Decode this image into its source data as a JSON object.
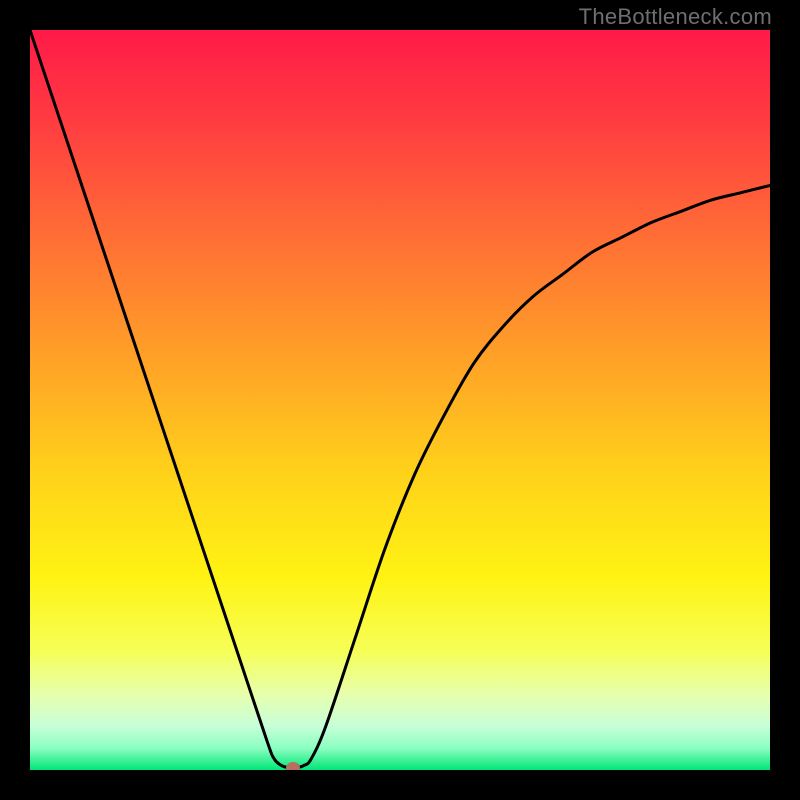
{
  "watermark": "TheBottleneck.com",
  "chart_data": {
    "type": "line",
    "title": "",
    "xlabel": "",
    "ylabel": "",
    "xlim": [
      0,
      100
    ],
    "ylim": [
      0,
      100
    ],
    "grid": false,
    "legend": false,
    "series": [
      {
        "name": "bottleneck-curve",
        "x": [
          0,
          4,
          8,
          12,
          16,
          20,
          24,
          28,
          32,
          33,
          34,
          35,
          36,
          37,
          38,
          40,
          44,
          48,
          52,
          56,
          60,
          64,
          68,
          72,
          76,
          80,
          84,
          88,
          92,
          96,
          100
        ],
        "values": [
          100,
          88,
          76,
          64,
          52,
          40,
          28,
          16,
          4,
          1.5,
          0.6,
          0.3,
          0.3,
          0.6,
          1.5,
          6,
          18,
          30,
          40,
          48,
          55,
          60,
          64,
          67,
          70,
          72,
          74,
          75.5,
          77,
          78,
          79
        ]
      }
    ],
    "marker": {
      "x": 35.5,
      "y": 0.3,
      "color": "#b96f5f"
    },
    "gradient_stops": [
      {
        "offset": 0.0,
        "color": "#ff1a48"
      },
      {
        "offset": 0.12,
        "color": "#ff3b41"
      },
      {
        "offset": 0.28,
        "color": "#ff6e35"
      },
      {
        "offset": 0.44,
        "color": "#ffa027"
      },
      {
        "offset": 0.6,
        "color": "#ffd21a"
      },
      {
        "offset": 0.74,
        "color": "#fff313"
      },
      {
        "offset": 0.84,
        "color": "#f6ff58"
      },
      {
        "offset": 0.9,
        "color": "#e6ffb0"
      },
      {
        "offset": 0.94,
        "color": "#c8ffd8"
      },
      {
        "offset": 0.97,
        "color": "#8cffc2"
      },
      {
        "offset": 1.0,
        "color": "#00e676"
      }
    ],
    "curve_color": "#000000",
    "curve_width": 3
  }
}
